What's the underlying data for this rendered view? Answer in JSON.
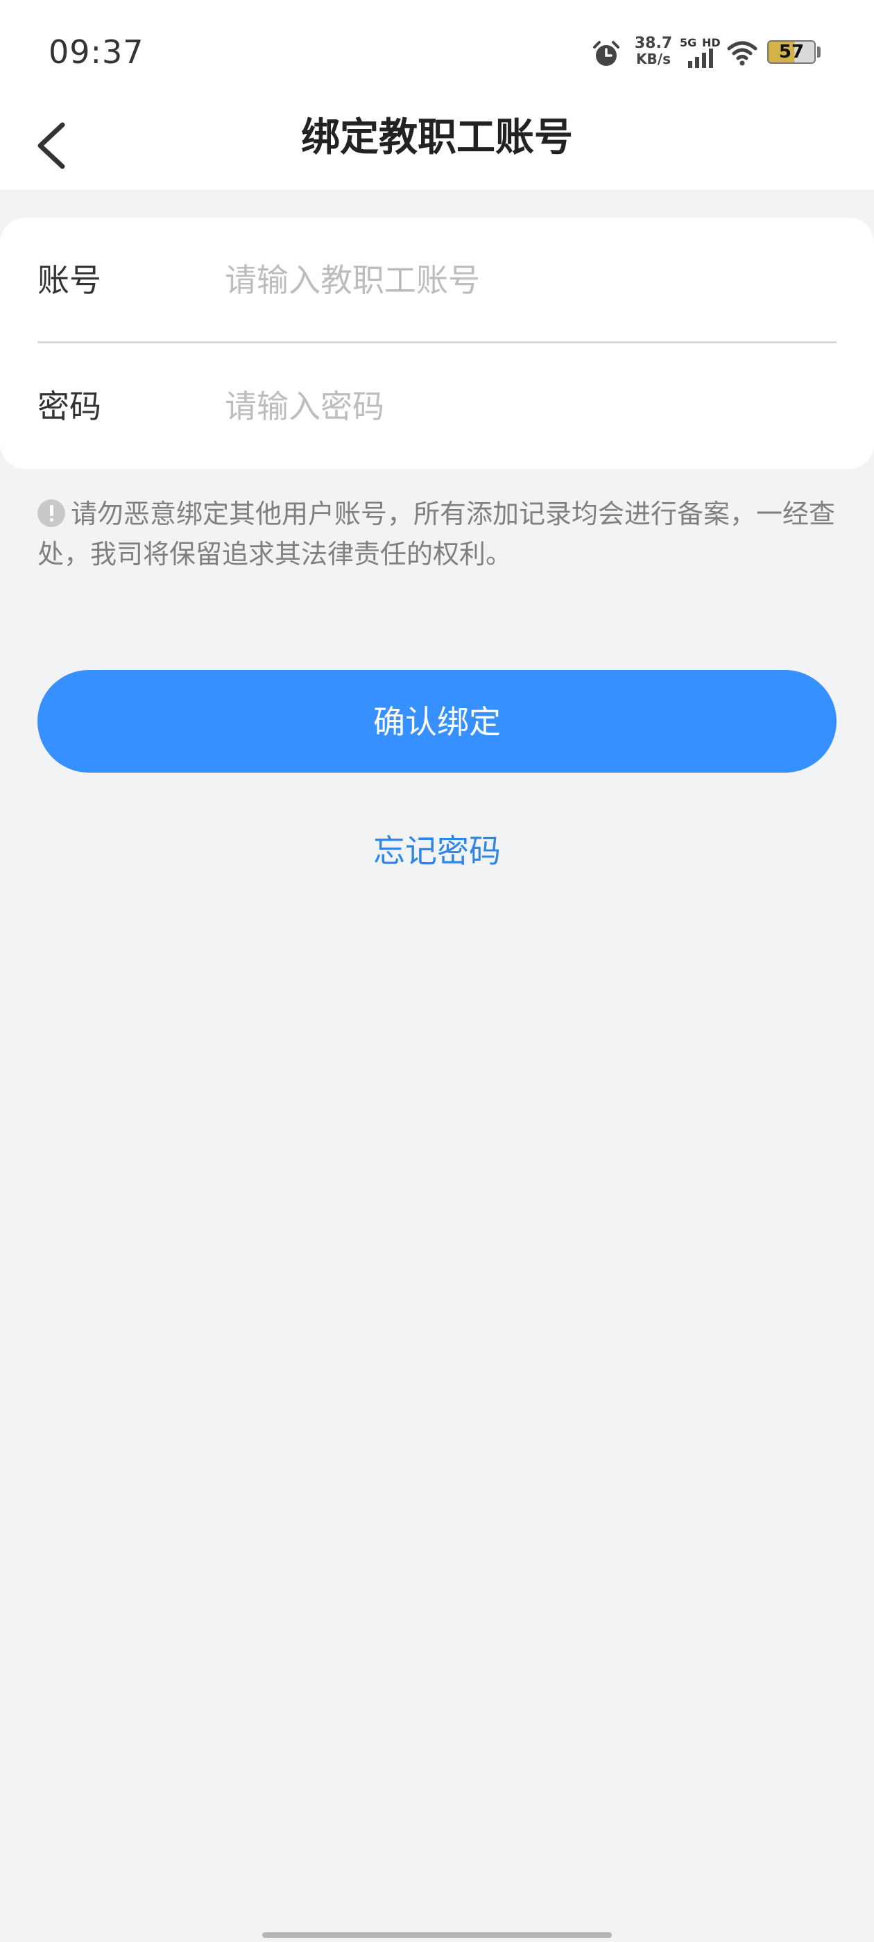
{
  "status_bar": {
    "time": "09:37",
    "net_speed_value": "38.7",
    "net_speed_unit": "KB/s",
    "network_type": "5G",
    "hd_label": "HD",
    "battery_level": "57",
    "icons": [
      "alarm-icon",
      "signal-bars-icon",
      "wifi-icon",
      "battery-icon"
    ]
  },
  "nav": {
    "title": "绑定教职工账号",
    "back_icon": "chevron-left-icon"
  },
  "form": {
    "account": {
      "label": "账号",
      "placeholder": "请输入教职工账号",
      "value": ""
    },
    "password": {
      "label": "密码",
      "placeholder": "请输入密码",
      "value": ""
    }
  },
  "notice": {
    "icon": "warning-icon",
    "text": "请勿恶意绑定其他用户账号，所有添加记录均会进行备案，一经查处，我司将保留追求其法律责任的权利。"
  },
  "actions": {
    "confirm_label": "确认绑定",
    "forgot_label": "忘记密码"
  },
  "colors": {
    "primary": "#3790FF",
    "link": "#2F86E8",
    "page_bg": "#F2F3F5",
    "card_bg": "#FFFFFF",
    "placeholder": "#BDBDBD",
    "notice_text": "#808080"
  }
}
